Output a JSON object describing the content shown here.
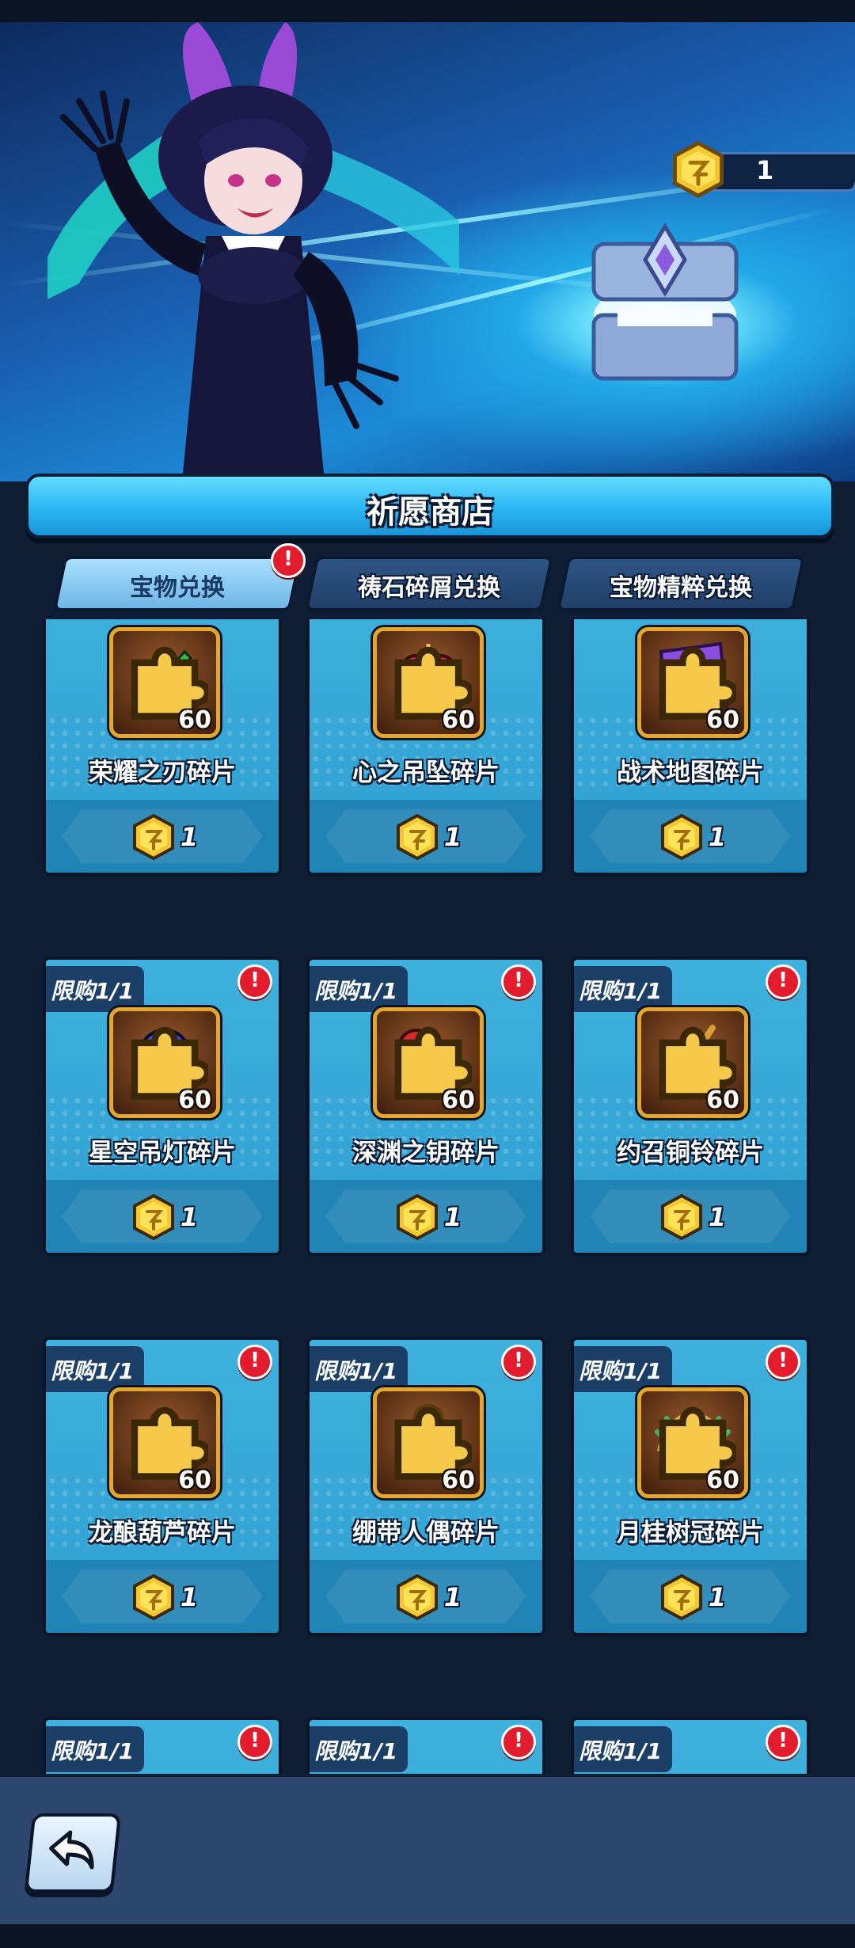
{
  "currency": {
    "amount": "1",
    "icon": "gold-token-icon"
  },
  "shop": {
    "title": "祈愿商店"
  },
  "tabs": [
    {
      "label": "宝物兑换",
      "active": true,
      "has_alert": true
    },
    {
      "label": "祷石碎屑兑换",
      "active": false,
      "has_alert": false
    },
    {
      "label": "宝物精粹兑换",
      "active": false,
      "has_alert": false
    }
  ],
  "alert_mark": "!",
  "items": [
    {
      "name": "荣耀之刃碎片",
      "qty": "60",
      "price": "1",
      "limit": "",
      "icon": "blade-icon",
      "color": "#3ab54a"
    },
    {
      "name": "心之吊坠碎片",
      "qty": "60",
      "price": "1",
      "limit": "",
      "icon": "heart-pendant-icon",
      "color": "#e0283a"
    },
    {
      "name": "战术地图碎片",
      "qty": "60",
      "price": "1",
      "limit": "",
      "icon": "map-icon",
      "color": "#8a4ee0"
    },
    {
      "name": "星空吊灯碎片",
      "qty": "60",
      "price": "1",
      "limit": "限购1/1",
      "icon": "orb-lamp-icon",
      "color": "#3a4ee8"
    },
    {
      "name": "深渊之钥碎片",
      "qty": "60",
      "price": "1",
      "limit": "限购1/1",
      "icon": "key-icon",
      "color": "#d8282a"
    },
    {
      "name": "约召铜铃碎片",
      "qty": "60",
      "price": "1",
      "limit": "限购1/1",
      "icon": "bell-icon",
      "color": "#e0b030"
    },
    {
      "name": "龙酿葫芦碎片",
      "qty": "60",
      "price": "1",
      "limit": "限购1/1",
      "icon": "gourd-icon",
      "color": "#e8a020"
    },
    {
      "name": "绷带人偶碎片",
      "qty": "60",
      "price": "1",
      "limit": "限购1/1",
      "icon": "doll-icon",
      "color": "#f0c040"
    },
    {
      "name": "月桂树冠碎片",
      "qty": "60",
      "price": "1",
      "limit": "限购1/1",
      "icon": "laurel-icon",
      "color": "#58c8e8"
    },
    {
      "name": "",
      "qty": "",
      "price": "",
      "limit": "限购1/1",
      "icon": "",
      "color": ""
    },
    {
      "name": "",
      "qty": "",
      "price": "",
      "limit": "限购1/1",
      "icon": "",
      "color": ""
    },
    {
      "name": "",
      "qty": "",
      "price": "",
      "limit": "限购1/1",
      "icon": "",
      "color": ""
    }
  ],
  "nav": {
    "back_icon": "back-arrow-icon"
  }
}
